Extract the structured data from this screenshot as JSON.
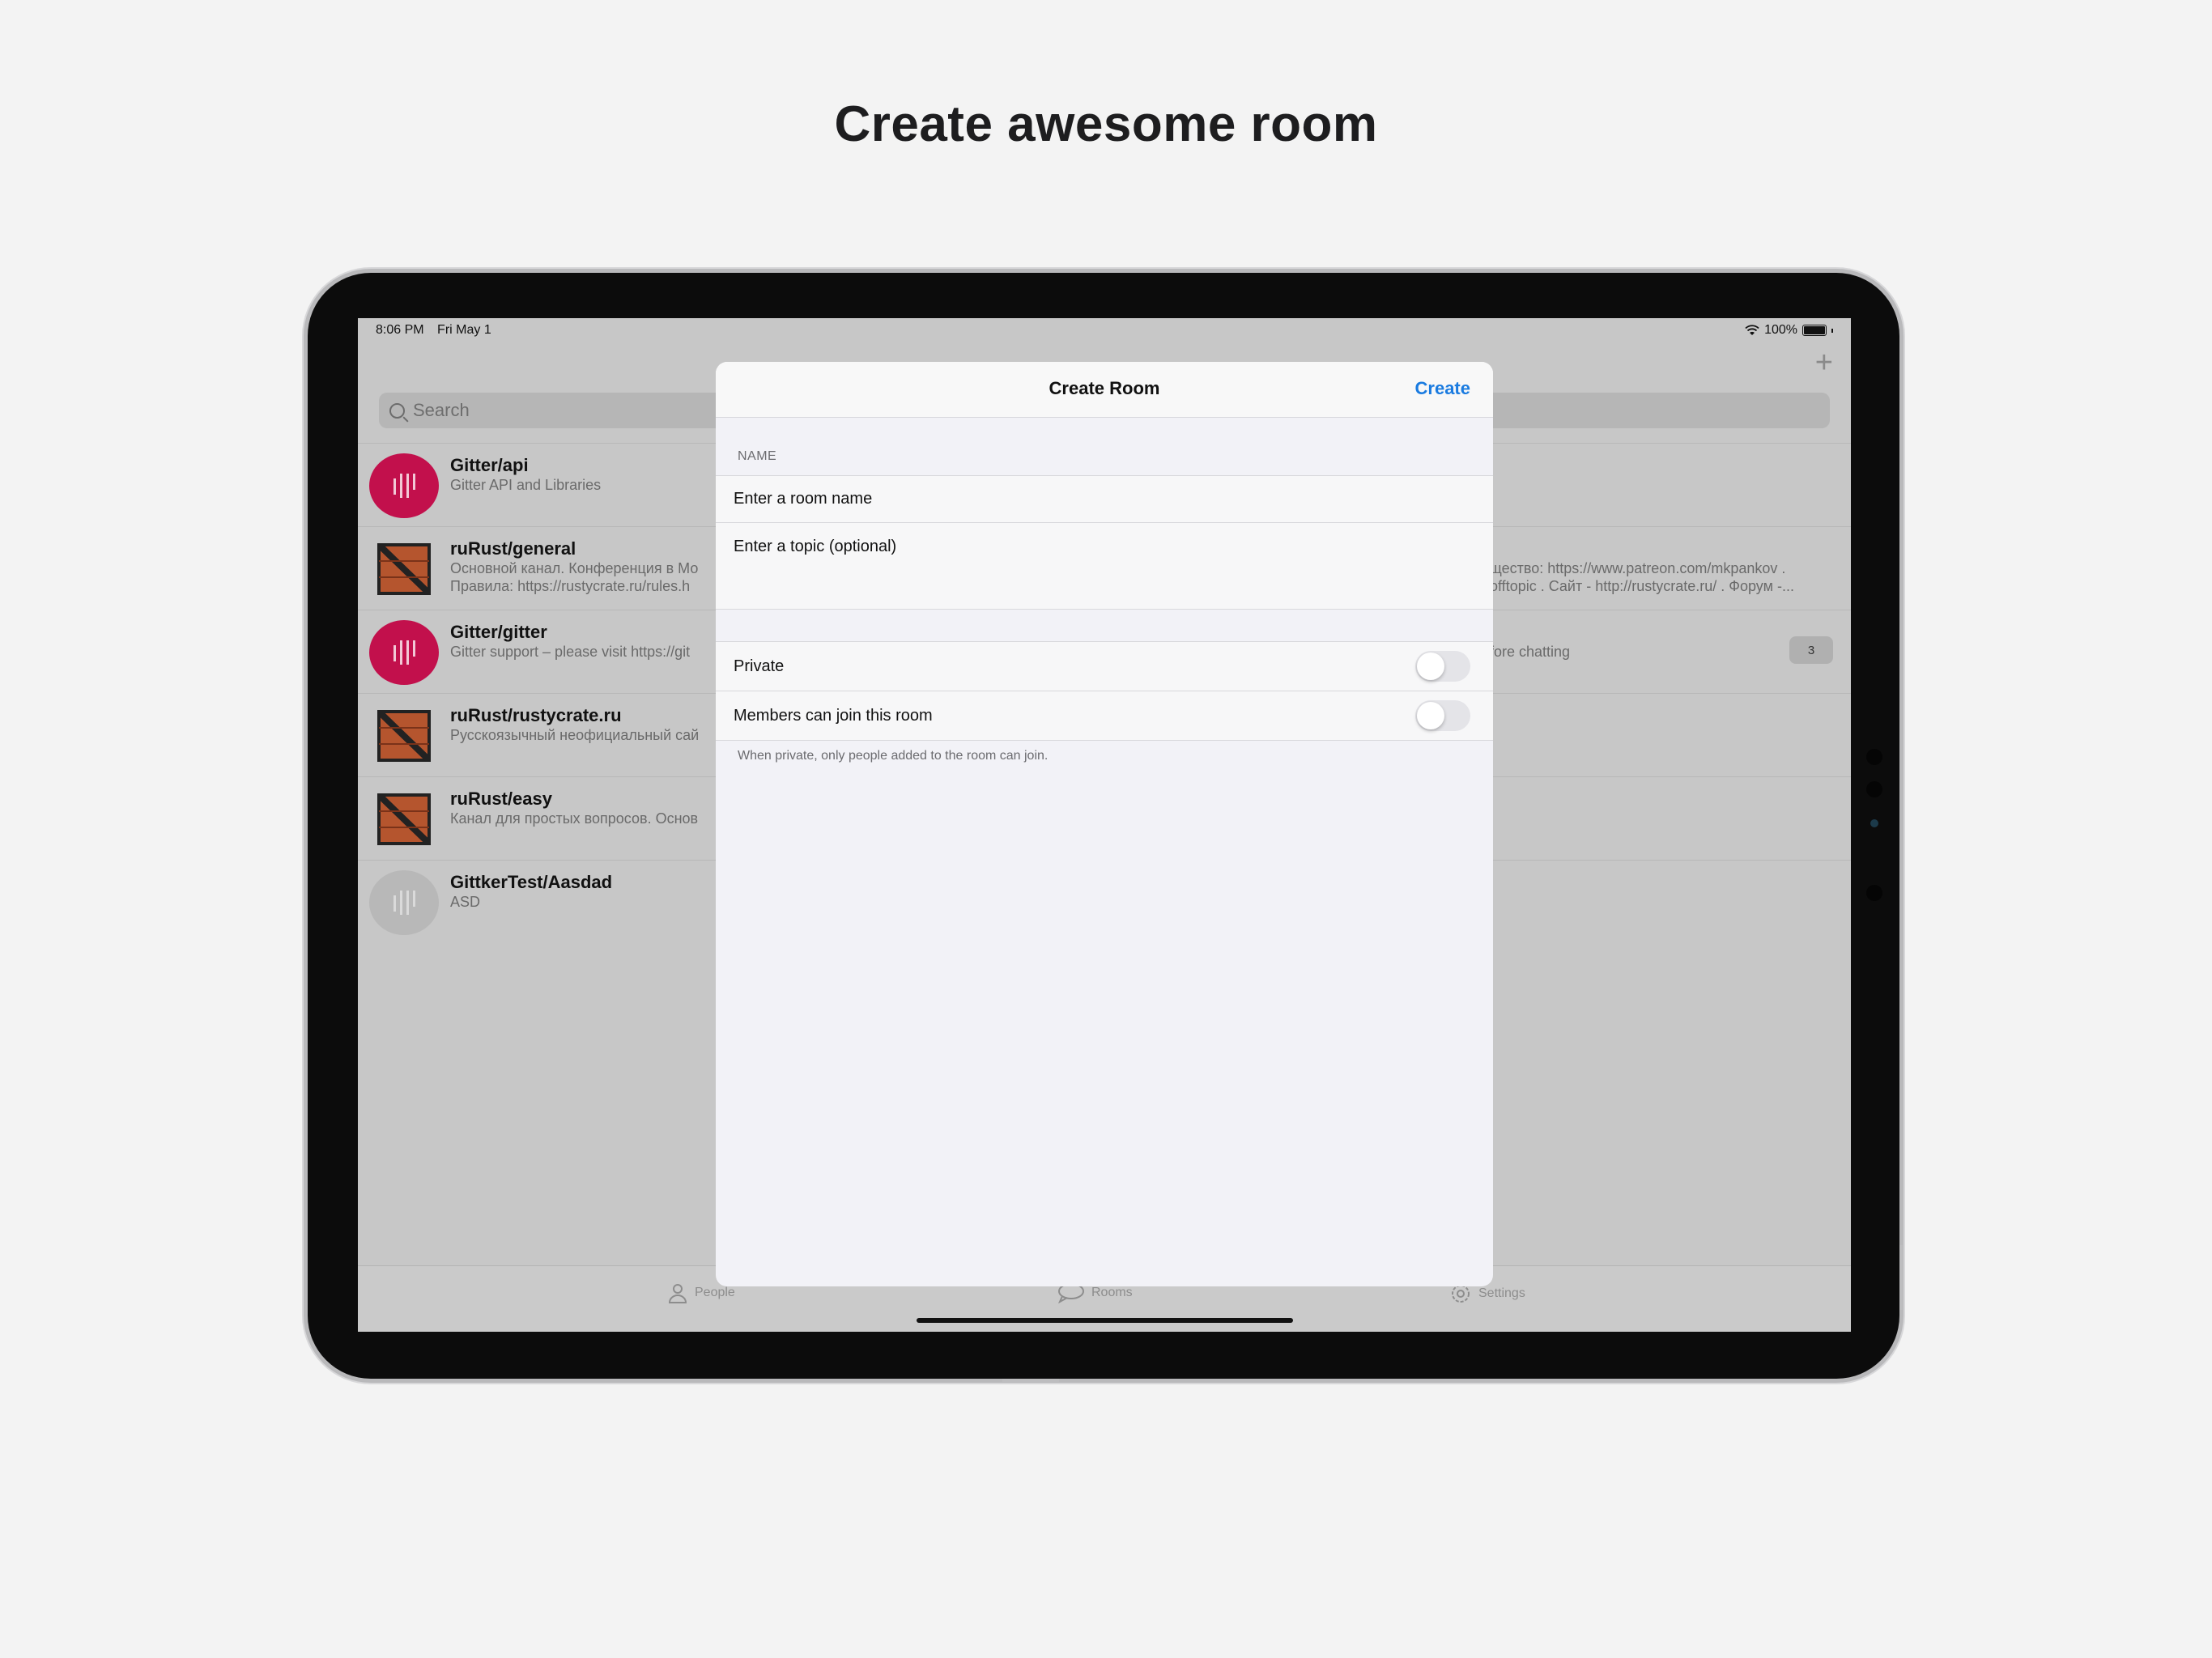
{
  "headline": "Create awesome room",
  "status_bar": {
    "time": "8:06 PM",
    "date": "Fri May 1",
    "battery": "100%"
  },
  "search": {
    "placeholder": "Search"
  },
  "rooms": [
    {
      "title": "Gitter/api",
      "subtitle": "Gitter API and Libraries",
      "right_text": "",
      "avatar": "gitter-logo",
      "badge": ""
    },
    {
      "title": "ruRust/general",
      "subtitle": "Основной канал. Конференция в Мо\nПравила: https://rustycrate.ru/rules.h",
      "right_text": "щество: https://www.patreon.com/mkpankov .\nofftopic . Сайт - http://rustycrate.ru/ . Форум -...",
      "avatar": "crate-logo",
      "badge": ""
    },
    {
      "title": "Gitter/gitter",
      "subtitle": "Gitter support – please visit https://git",
      "right_text": "fore chatting",
      "avatar": "gitter-logo",
      "badge": "3"
    },
    {
      "title": "ruRust/rustycrate.ru",
      "subtitle": "Русскоязычный неофициальный сай",
      "right_text": "",
      "avatar": "crate-logo",
      "badge": ""
    },
    {
      "title": "ruRust/easy",
      "subtitle": "Канал для простых вопросов. Основ",
      "right_text": "",
      "avatar": "crate-logo",
      "badge": ""
    },
    {
      "title": "GittkerTest/Aasdad",
      "subtitle": "ASD",
      "right_text": "",
      "avatar": "gitter-logo-grey",
      "badge": ""
    }
  ],
  "tabbar": {
    "people": "People",
    "rooms": "Rooms",
    "settings": "Settings"
  },
  "modal": {
    "title": "Create Room",
    "create": "Create",
    "section_label": "NAME",
    "name_placeholder": "Enter a room name",
    "topic_placeholder": "Enter a topic (optional)",
    "private_label": "Private",
    "private_on": false,
    "members_label": "Members can join this room",
    "members_on": false,
    "footnote": "When private, only people added to the room can join."
  },
  "colors": {
    "accent": "#1a7be0",
    "gitter": "#c2104c",
    "crate": "#b5552e"
  }
}
